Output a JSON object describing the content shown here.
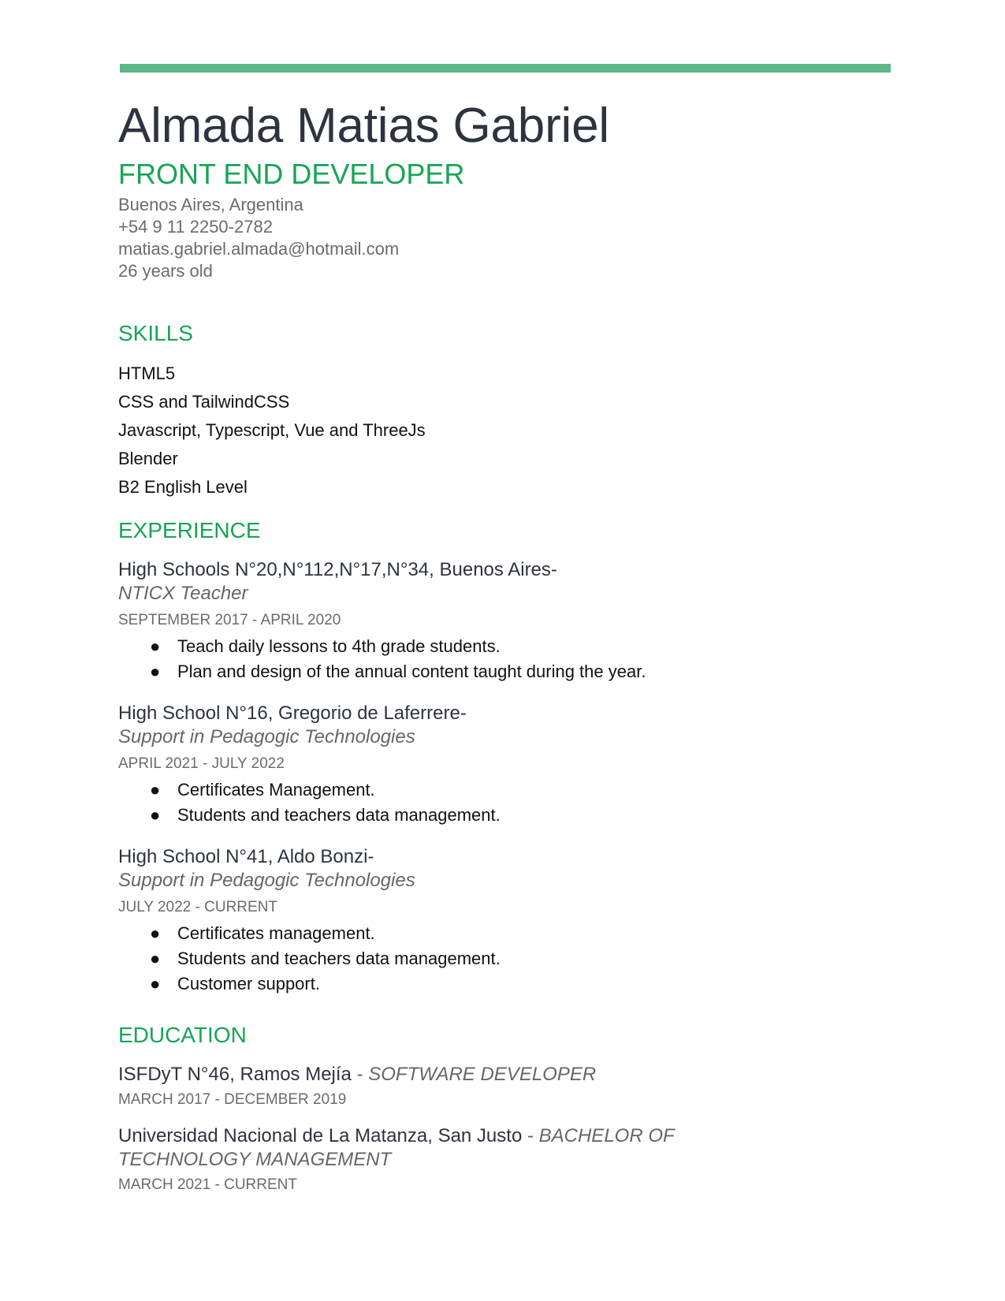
{
  "header": {
    "name": "Almada Matias Gabriel",
    "role": "FRONT END DEVELOPER",
    "location": "Buenos Aires, Argentina",
    "phone": "+54 9 11 2250-2782",
    "email": "matias.gabriel.almada@hotmail.com",
    "age": "26 years old",
    "accent_color": "#17a556",
    "rule_color": "#5cb985"
  },
  "skills": {
    "title": "SKILLS",
    "items": [
      "HTML5",
      "CSS and TailwindCSS",
      "Javascript, Typescript, Vue and ThreeJs",
      "Blender",
      "B2 English Level"
    ]
  },
  "experience": {
    "title": "EXPERIENCE",
    "jobs": [
      {
        "org": "High Schools N°20,N°112,N°17,N°34,  Buenos Aires-",
        "role": "NTICX Teacher",
        "dates": "SEPTEMBER 2017 - APRIL 2020",
        "bullets": [
          "Teach daily lessons to 4th grade students.",
          "Plan and design of the annual content taught during the year."
        ]
      },
      {
        "org": "High School N°16,  Gregorio de Laferrere-",
        "role": "Support in Pedagogic Technologies",
        "dates": "APRIL 2021 - JULY 2022",
        "bullets": [
          "Certificates Management.",
          "Students and teachers data management."
        ]
      },
      {
        "org": "High School N°41, Aldo Bonzi-",
        "role": "Support in Pedagogic Technologies",
        "dates": "JULY 2022 - CURRENT",
        "bullets": [
          "Certificates management.",
          "Students and teachers data management.",
          "Customer support."
        ]
      }
    ]
  },
  "education": {
    "title": "EDUCATION",
    "items": [
      {
        "institution": "ISFDyT N°46, Ramos Mejía",
        "separator": " - ",
        "degree": "SOFTWARE DEVELOPER",
        "dates": "MARCH 2017 - DECEMBER 2019"
      },
      {
        "institution": "Universidad Nacional de La Matanza, San Justo",
        "separator": " - ",
        "degree": "BACHELOR OF TECHNOLOGY MANAGEMENT",
        "dates": "MARCH 2021 - CURRENT"
      }
    ]
  },
  "bullet_glyph": "●"
}
